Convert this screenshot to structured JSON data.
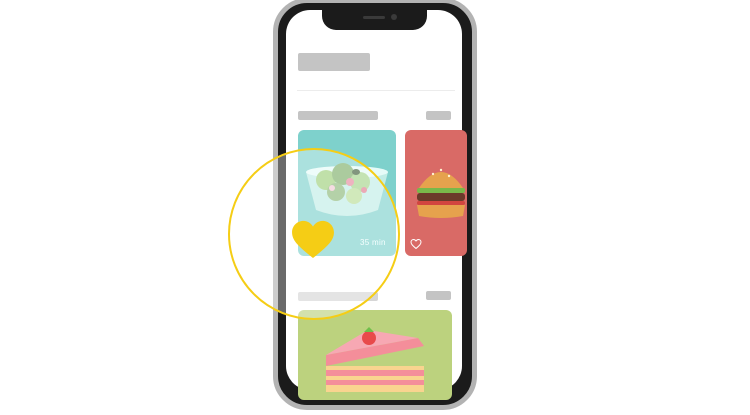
{
  "app": {
    "cards": [
      {
        "name": "salad",
        "time": "35 min",
        "favorite": true
      },
      {
        "name": "burger",
        "favorite": false
      },
      {
        "name": "cake"
      }
    ]
  },
  "colors": {
    "accent_yellow": "#f5cd15",
    "salad_card": "#7ed1cc",
    "burger_card": "#d96a66",
    "cake_card": "#bcd27e",
    "placeholder": "#c4c4c4"
  },
  "icons": {
    "favorite_active": "heart-filled-icon",
    "favorite_inactive": "heart-outline-icon"
  }
}
